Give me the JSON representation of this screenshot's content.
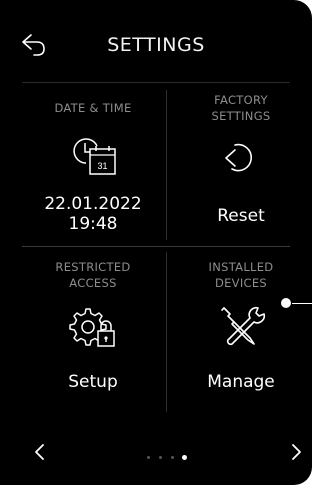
{
  "header": {
    "title": "SETTINGS",
    "back_icon": "back-arrow-icon"
  },
  "tiles": {
    "date_time": {
      "label": "DATE & TIME",
      "date": "22.01.2022",
      "time": "19:48",
      "icon": "clock-calendar-icon",
      "calendar_day": "31"
    },
    "factory": {
      "label_line1": "FACTORY",
      "label_line2": "SETTINGS",
      "action": "Reset",
      "icon": "reset-icon"
    },
    "restricted": {
      "label_line1": "RESTRICTED",
      "label_line2": "ACCESS",
      "action": "Setup",
      "icon": "gear-lock-icon"
    },
    "installed": {
      "label_line1": "INSTALLED",
      "label_line2": "DEVICES",
      "action": "Manage",
      "icon": "tools-icon"
    }
  },
  "pager": {
    "pages": 4,
    "active_index": 3
  },
  "colors": {
    "background": "#000000",
    "text": "#ffffff",
    "label": "#8d8d8d",
    "divider": "#2e2e2e"
  }
}
